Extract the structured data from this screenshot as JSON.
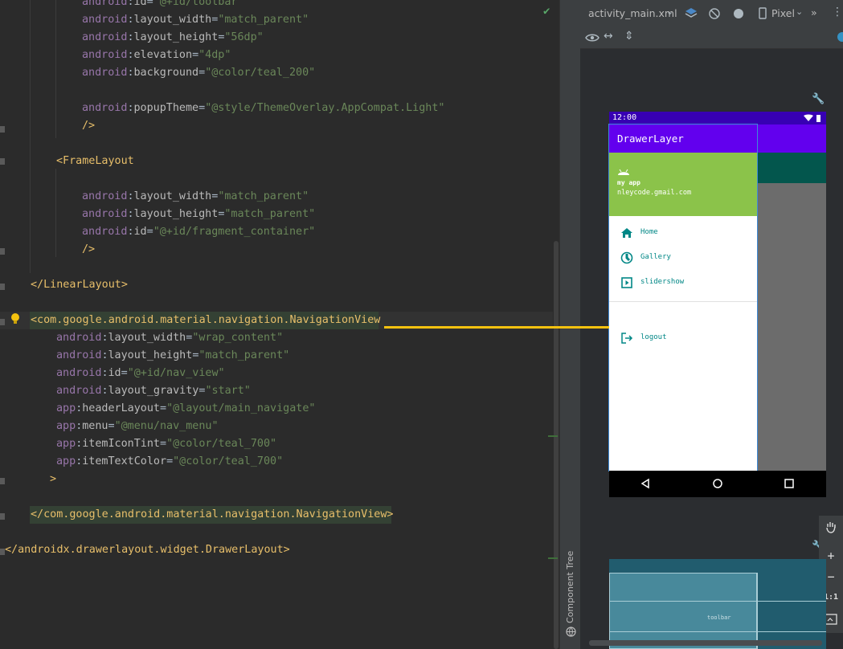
{
  "editor": {
    "lines": [
      {
        "ns": "android",
        "attr": "id",
        "val": "\"@+id/toolbar\""
      },
      {
        "ns": "android",
        "attr": "layout_width",
        "val": "\"match_parent\""
      },
      {
        "ns": "android",
        "attr": "layout_height",
        "val": "\"56dp\""
      },
      {
        "ns": "android",
        "attr": "elevation",
        "val": "\"4dp\""
      },
      {
        "ns": "android",
        "attr": "background",
        "val": "\"@color/teal_200\""
      },
      {
        "ns": "android",
        "attr": "popupTheme",
        "val": "\"@style/ThemeOverlay.AppCompat.Light\""
      },
      {
        "close": "/>"
      },
      {
        "tag": "<FrameLayout"
      },
      {
        "ns": "android",
        "attr": "layout_width",
        "val": "\"match_parent\""
      },
      {
        "ns": "android",
        "attr": "layout_height",
        "val": "\"match_parent\""
      },
      {
        "ns": "android",
        "attr": "id",
        "val": "\"@+id/fragment_container\""
      },
      {
        "close": "/>"
      },
      {
        "tag": "</LinearLayout>"
      },
      {
        "tag": "<com.google.android.material.navigation.NavigationView"
      },
      {
        "ns": "android",
        "attr": "layout_width",
        "val": "\"wrap_content\""
      },
      {
        "ns": "android",
        "attr": "layout_height",
        "val": "\"match_parent\""
      },
      {
        "ns": "android",
        "attr": "id",
        "val": "\"@+id/nav_view\""
      },
      {
        "ns": "android",
        "attr": "layout_gravity",
        "val": "\"start\""
      },
      {
        "ns": "app",
        "attr": "headerLayout",
        "val": "\"@layout/main_navigate\""
      },
      {
        "ns": "app",
        "attr": "menu",
        "val": "\"@menu/nav_menu\""
      },
      {
        "ns": "app",
        "attr": "itemIconTint",
        "val": "\"@color/teal_700\""
      },
      {
        "ns": "app",
        "attr": "itemTextColor",
        "val": "\"@color/teal_700\""
      },
      {
        "close": ">"
      },
      {
        "tag": "</com.google.android.material.navigation.NavigationView>"
      },
      {
        "tag": "</androidx.drawerlayout.widget.DrawerLayout>"
      }
    ]
  },
  "sidebar_strip": {
    "label": "Component Tree"
  },
  "design_toolbar": {
    "file_name": "activity_main.xml",
    "device": "Pixel",
    "more": "»"
  },
  "preview": {
    "status_time": "12:00",
    "app_title": "DrawerLayer",
    "header_name": "my app",
    "header_email": "nleycode.gmail.com",
    "menu": [
      {
        "label": "Home",
        "icon": "home-icon"
      },
      {
        "label": "Gallery",
        "icon": "gallery-icon"
      },
      {
        "label": "slidershow",
        "icon": "slideshow-icon"
      },
      {
        "label": "logout",
        "icon": "logout-icon"
      }
    ]
  },
  "blueprint": {
    "label": "toolbar"
  },
  "zoom": {
    "zoom_in": "+",
    "zoom_out": "−",
    "actual_size": "1:1"
  },
  "colors": {
    "status_bar": "#3700b3",
    "app_bar": "#6200ee",
    "header": "#8bc34a",
    "teal_700": "#018786",
    "connector": "#f5c20f"
  }
}
